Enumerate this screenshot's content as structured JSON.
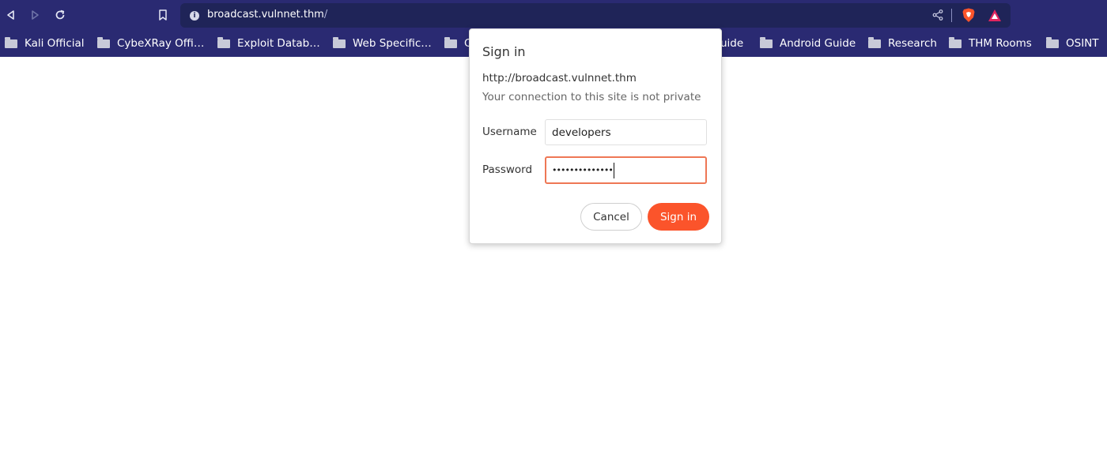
{
  "browser": {
    "url_host": "broadcast.vulnnet.thm",
    "url_path": "/",
    "info_icon": "i"
  },
  "bookmarks": [
    {
      "label": "Kali Official"
    },
    {
      "label": "CybeXRay Offi…"
    },
    {
      "label": "Exploit Datab…"
    },
    {
      "label": "Web Specific…"
    },
    {
      "label": "C"
    },
    {
      "label": "uide"
    },
    {
      "label": "Android Guide"
    },
    {
      "label": "Research"
    },
    {
      "label": "THM Rooms"
    },
    {
      "label": "OSINT"
    }
  ],
  "dialog": {
    "title": "Sign in",
    "origin": "http://broadcast.vulnnet.thm",
    "warning": "Your connection to this site is not private",
    "username_label": "Username",
    "username_value": "developers",
    "password_label": "Password",
    "password_masked": "••••••••••••••",
    "cancel_label": "Cancel",
    "signin_label": "Sign in"
  },
  "colors": {
    "toolbar_bg": "#2a2a72",
    "urlbar_bg": "#1f2458",
    "accent": "#fb542b",
    "focus_border": "#ee7755"
  },
  "icons": [
    "back-icon",
    "forward-icon",
    "reload-icon",
    "bookmark-icon",
    "site-info-icon",
    "share-icon",
    "brave-shields-icon",
    "brave-rewards-icon",
    "folder-icon"
  ]
}
